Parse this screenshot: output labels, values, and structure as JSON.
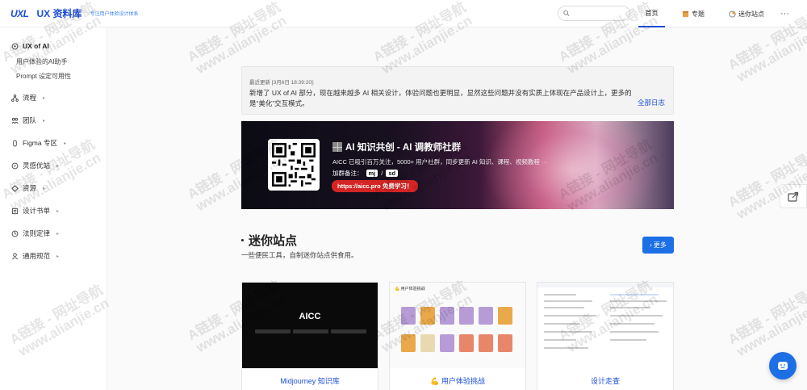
{
  "header": {
    "logo_mark": "UXL",
    "logo_text": "UX 资料库",
    "logo_subtitle": "专注用户体验设计体系",
    "search_placeholder": "",
    "nav": {
      "home": "首页",
      "topic": "专题",
      "mini": "迷你站点",
      "more": "···"
    }
  },
  "sidebar": {
    "items": [
      {
        "label": "UX of AI",
        "icon": "brain-icon",
        "active": true
      },
      {
        "label": "流程",
        "icon": "flow-icon"
      },
      {
        "label": "团队",
        "icon": "team-icon"
      },
      {
        "label": "Figma 专区",
        "icon": "figma-icon"
      },
      {
        "label": "灵感优站",
        "icon": "compass-icon"
      },
      {
        "label": "资源",
        "icon": "resource-icon"
      },
      {
        "label": "设计书单",
        "icon": "book-icon"
      },
      {
        "label": "法则定律",
        "icon": "law-icon"
      },
      {
        "label": "通用规范",
        "icon": "rules-icon"
      }
    ],
    "sub_items": [
      "用户体验的AI助手",
      "Prompt 设定可用性"
    ]
  },
  "notice": {
    "time": "最近更新 [3月6日 18:39:20]:",
    "text": "新增了 UX of AI 部分，现在越来越多 AI 相关设计，体验问题也更明显，显然这些问题并没有实质上体现在产品设计上，更多的是“美化”交互模式。",
    "link": "全部日志"
  },
  "banner": {
    "title": "AI 知识共创 - AI 调教师社群",
    "desc": "AICC 已吸引百万关注，5000+ 用户社群，同步更新 AI 知识、课程、视频教程 ···",
    "tag_prefix": "加群备注：",
    "tag1": "mj",
    "tag_sep": "/",
    "tag2": "sd",
    "cta": "https://aicc.pro 免费学习！"
  },
  "section": {
    "title": "迷你站点",
    "subtitle": "一些便民工具，自制迷你站点供食用。",
    "more_label": "更多"
  },
  "cards": [
    {
      "label": "Midjourney 知识库",
      "thumb_text": "AICC"
    },
    {
      "label": "💪 用户体验挑战",
      "thumb_text": "💪 用户体验挑战"
    },
    {
      "label": "设计走查",
      "thumb_text": ""
    }
  ],
  "watermark": {
    "line1": "A链接 - 网址导航",
    "line2": "www.alianjie.cn"
  },
  "colors": {
    "accent": "#1d4ed8",
    "button": "#1d6fe6",
    "cta": "#d42424"
  }
}
